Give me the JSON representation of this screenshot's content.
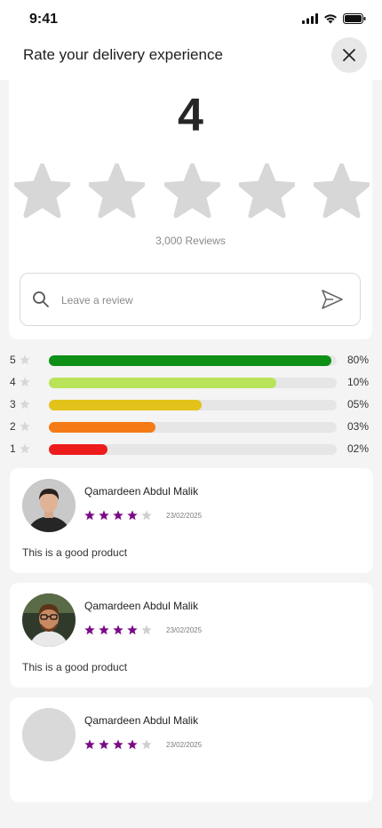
{
  "status": {
    "time": "9:41"
  },
  "header": {
    "title": "Rate your delivery experience"
  },
  "summary": {
    "rating": "4",
    "stars_total": 5,
    "reviews_count": "3,000 Reviews",
    "input_placeholder": "Leave a review"
  },
  "distribution": [
    {
      "label": "5",
      "percent_text": "80%",
      "fill_fraction": 0.98,
      "color": "#0e8f16"
    },
    {
      "label": "4",
      "percent_text": "10%",
      "fill_fraction": 0.79,
      "color": "#b8e35a"
    },
    {
      "label": "3",
      "percent_text": "05%",
      "fill_fraction": 0.53,
      "color": "#e3c21b"
    },
    {
      "label": "2",
      "percent_text": "03%",
      "fill_fraction": 0.37,
      "color": "#f47b16"
    },
    {
      "label": "1",
      "percent_text": "02%",
      "fill_fraction": 0.205,
      "color": "#ee1b1b"
    }
  ],
  "reviews": [
    {
      "name": "Qamardeen Abdul Malik",
      "rating": 4,
      "date": "23/02/2025",
      "text": "This is a good product",
      "avatar": "person-dark"
    },
    {
      "name": "Qamardeen Abdul Malik",
      "rating": 4,
      "date": "23/02/2025",
      "text": "This is a good product",
      "avatar": "person-glasses"
    },
    {
      "name": "Qamardeen Abdul Malik",
      "rating": 4,
      "date": "23/02/2025",
      "text": "",
      "avatar": "placeholder"
    }
  ],
  "colors": {
    "star_inactive": "#d7d7d7",
    "star_review": "#7b0a86",
    "star_review_off": "#cfcfcf"
  }
}
